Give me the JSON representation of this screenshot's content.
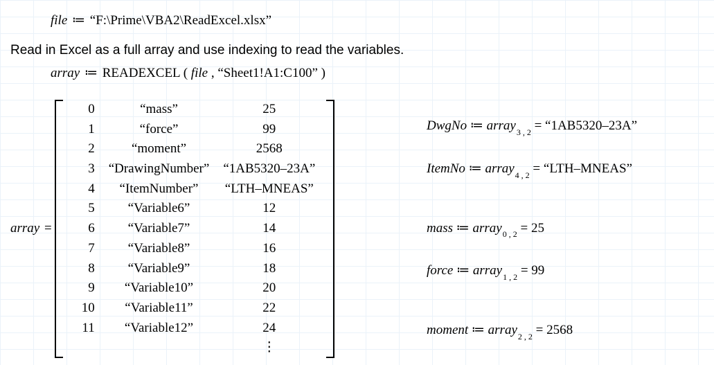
{
  "line1": {
    "lhs": "file",
    "op": "≔",
    "rhs": "“F:\\Prime\\VBA2\\ReadExcel.xlsx”"
  },
  "description": "Read in Excel as a full array and use indexing to read the variables.",
  "line2": {
    "lhs": "array",
    "op": "≔",
    "func": "READEXCEL",
    "open": "(",
    "arg1": "file",
    "comma": " , ",
    "arg2": "“Sheet1!A1:C100”",
    "close": ")"
  },
  "matrix": {
    "lhs": "array",
    "eq": "=",
    "rows": [
      {
        "c0": "0",
        "c1": "“mass”",
        "c2": "25"
      },
      {
        "c0": "1",
        "c1": "“force”",
        "c2": "99"
      },
      {
        "c0": "2",
        "c1": "“moment”",
        "c2": "2568"
      },
      {
        "c0": "3",
        "c1": "“DrawingNumber”",
        "c2": "“1AB5320–23A”"
      },
      {
        "c0": "4",
        "c1": "“ItemNumber”",
        "c2": "“LTH–MNEAS”"
      },
      {
        "c0": "5",
        "c1": "“Variable6”",
        "c2": "12"
      },
      {
        "c0": "6",
        "c1": "“Variable7”",
        "c2": "14"
      },
      {
        "c0": "7",
        "c1": "“Variable8”",
        "c2": "16"
      },
      {
        "c0": "8",
        "c1": "“Variable9”",
        "c2": "18"
      },
      {
        "c0": "9",
        "c1": "“Variable10”",
        "c2": "20"
      },
      {
        "c0": "10",
        "c1": "“Variable11”",
        "c2": "22"
      },
      {
        "c0": "11",
        "c1": "“Variable12”",
        "c2": "24"
      }
    ],
    "vdots": "⋮"
  },
  "right": [
    {
      "var": "DwgNo",
      "op": "≔",
      "src": "array",
      "sub": "3 , 2",
      "eq": "=",
      "val": "“1AB5320–23A”"
    },
    {
      "var": "ItemNo",
      "op": "≔",
      "src": "array",
      "sub": "4 , 2",
      "eq": "=",
      "val": "“LTH–MNEAS”"
    },
    {
      "var": "mass",
      "op": "≔",
      "src": "array",
      "sub": "0 , 2",
      "eq": "=",
      "val": "25"
    },
    {
      "var": "force",
      "op": "≔",
      "src": "array",
      "sub": "1 , 2",
      "eq": "=",
      "val": "99"
    },
    {
      "var": "moment",
      "op": "≔",
      "src": "array",
      "sub": "2 , 2",
      "eq": "=",
      "val": "2568"
    }
  ]
}
